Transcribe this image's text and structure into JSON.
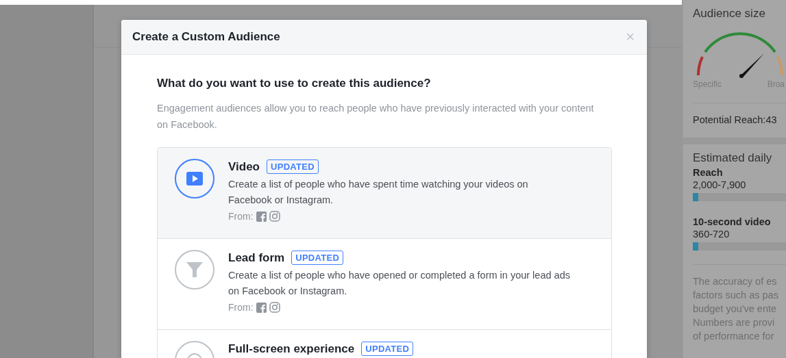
{
  "dialog": {
    "title": "Create a Custom Audience",
    "close": "×",
    "question": "What do you want to use to create this audience?",
    "description": "Engagement audiences allow you to reach people who have previously interacted with your content on Facebook.",
    "options": [
      {
        "kind": "video",
        "title": "Video",
        "badge": "UPDATED",
        "description": "Create a list of people who have spent time watching your videos on Facebook or Instagram.",
        "from": "From:",
        "selected": true
      },
      {
        "kind": "lead_form",
        "title": "Lead form",
        "badge": "UPDATED",
        "description": "Create a list of people who have opened or completed a form in your lead ads on Facebook or Instagram.",
        "from": "From:",
        "selected": false
      },
      {
        "kind": "full_screen",
        "title": "Full-screen experience",
        "badge": "UPDATED",
        "selected": false
      }
    ]
  },
  "sidebar": {
    "audience_size": {
      "title": "Audience size",
      "low_label": "Specific",
      "high_label": "Broa",
      "potential_reach": "Potential Reach:43"
    },
    "estimated": {
      "title": "Estimated daily",
      "metrics": [
        {
          "label": "Reach",
          "value": "2,000-7,900",
          "level": 0.06
        },
        {
          "label": "10-second video",
          "value": "360-720",
          "level": 0.06
        }
      ],
      "note_lines": [
        "The accuracy of es",
        "factors such as pas",
        "budget you've ente",
        "Numbers are provi",
        "of performance for"
      ]
    }
  }
}
